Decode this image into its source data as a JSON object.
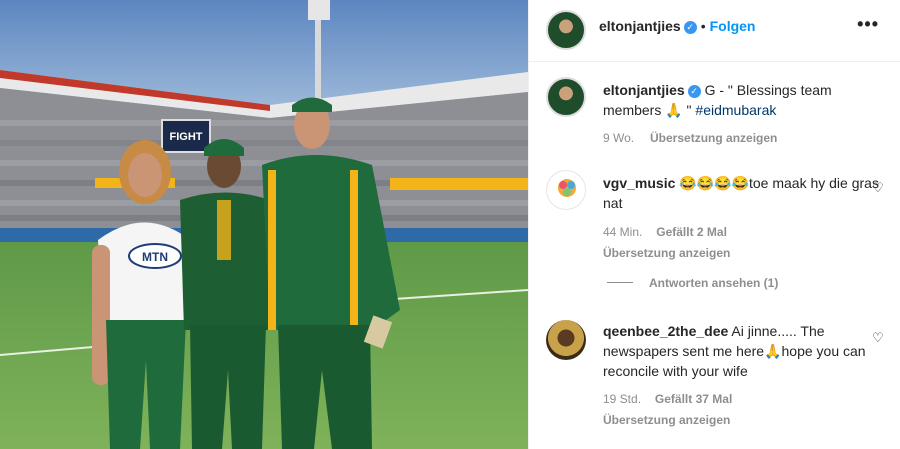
{
  "post": {
    "author": "eltonjantjies",
    "follow_label": "Folgen",
    "more_label": "•••",
    "dot": "•"
  },
  "caption": {
    "username": "eltonjantjies",
    "text_prefix": "G - \" Blessings team members 🙏 \" ",
    "hashtag": "#eidmubarak",
    "age": "9 Wo.",
    "translate": "Übersetzung anzeigen"
  },
  "comments": [
    {
      "username": "vgv_music",
      "text": "😂😂😂😂toe maak hy die gras nat",
      "age": "44 Min.",
      "likes": "Gefällt 2 Mal",
      "translate": "Übersetzung anzeigen",
      "view_replies": "Antworten ansehen (1)"
    },
    {
      "username": "qeenbee_2the_dee",
      "text": "Ai jinne..... The newspapers sent me here🙏hope you can reconcile with your wife",
      "age": "19 Std.",
      "likes": "Gefällt 37 Mal",
      "translate": "Übersetzung anzeigen"
    }
  ],
  "photo": {
    "shirt_text": "MTN",
    "screen_text": "FIGHT"
  },
  "colors": {
    "accent": "#0095f6",
    "verified": "#3897f0",
    "secondary_text": "#8e8e8e",
    "hashtag": "#00376b"
  }
}
